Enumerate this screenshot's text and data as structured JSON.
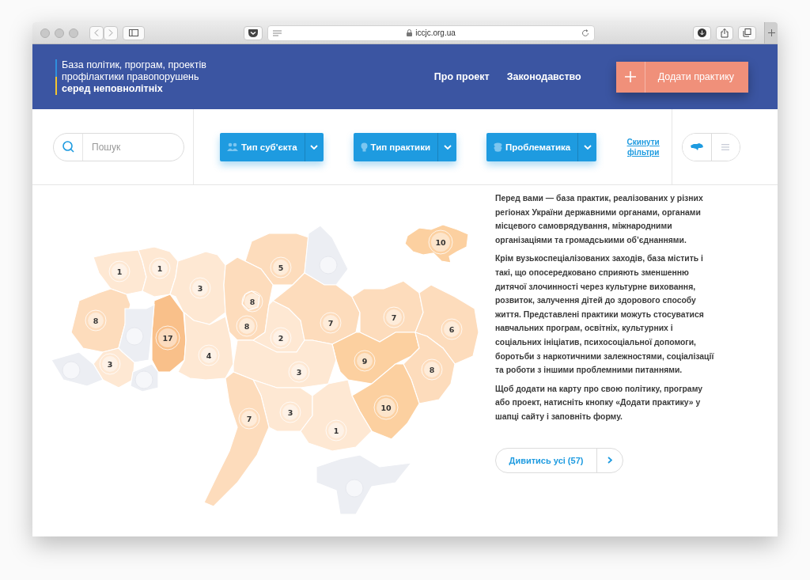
{
  "browser": {
    "url": "iccjc.org.ua"
  },
  "header": {
    "logo_lines": [
      "База політик, програм, проектів",
      "профілактики правопорушень",
      "серед неповнолітніх"
    ],
    "nav": [
      "Про проект",
      "Законодавство"
    ],
    "add_button": "Додати практику"
  },
  "filters": {
    "search": {
      "placeholder": "Пошук"
    },
    "dropdowns": [
      {
        "label": "Тип суб'єкта",
        "kind": "people"
      },
      {
        "label": "Тип практики",
        "kind": "bulb"
      },
      {
        "label": "Проблематика",
        "kind": "coins"
      }
    ],
    "reset_link": "Скинути фільтри",
    "view_toggle": [
      {
        "kind": "map",
        "selected": true
      },
      {
        "kind": "list",
        "selected": false
      }
    ]
  },
  "map": {
    "regions": [
      {
        "count": "1",
        "color": "#fee8d3"
      },
      {
        "count": "1",
        "color": "#fee8d3"
      },
      {
        "count": "3",
        "color": "#fee8d3"
      },
      {
        "count": "5",
        "color": "#fddcbc"
      },
      {
        "count": "8",
        "color": "#fddcbc"
      },
      {
        "count": "8",
        "color": "#fddcbc"
      },
      {
        "kind": "empty",
        "color": "#eceef3"
      },
      {
        "count": "8",
        "color": "#fddcbc"
      },
      {
        "count": "17",
        "color": "#f9c08a"
      },
      {
        "count": "2",
        "color": "#fee8d3"
      },
      {
        "count": "7",
        "color": "#fddcbc"
      },
      {
        "count": "7",
        "color": "#fddcbc"
      },
      {
        "count": "6",
        "color": "#fddcbc"
      },
      {
        "count": "4",
        "color": "#fee8d3"
      },
      {
        "count": "3",
        "color": "#fee8d3"
      },
      {
        "count": "9",
        "color": "#fcd0a0"
      },
      {
        "count": "3",
        "color": "#fee8d3"
      },
      {
        "count": "8",
        "color": "#fddcbc"
      },
      {
        "kind": "empty",
        "color": "#eceef3"
      },
      {
        "kind": "empty",
        "color": "#eceef3"
      },
      {
        "kind": "empty",
        "color": "#eceef3"
      },
      {
        "count": "10",
        "color": "#fcd0a0"
      },
      {
        "count": "3",
        "color": "#fee8d3"
      },
      {
        "count": "7",
        "color": "#fddcbc"
      },
      {
        "count": "1",
        "color": "#fee8d3"
      },
      {
        "kind": "empty",
        "color": "#eceef3"
      },
      {
        "count": "10",
        "color": "#fcd0a0"
      }
    ]
  },
  "description": {
    "paragraphs": [
      "Перед вами — база практик, реалізованих у різних регіонах України державними органами, органами місцевого самоврядування, міжнародними організаціями та громадськими об’єднаннями.",
      "Крім вузькоспеціалізованих заходів, база містить і такі, що опосередковано сприяють зменшенню дитячої злочинності через культурне виховання, розвиток, залучення дітей до здорового способу життя. Представлені практики можуть стосуватися навчальних програм, освітніх, культурних і соціальних ініціатив, психосоціальної допомоги, боротьби з наркотичними залежностями, соціалізації та роботи з іншими проблемними питаннями.",
      "Щоб додати на карту про свою політику, програму або проект, натисніть кнопку «Додати практику» у шапці сайту і заповніть форму."
    ],
    "view_all_button": "Дивитись усі (57)"
  }
}
